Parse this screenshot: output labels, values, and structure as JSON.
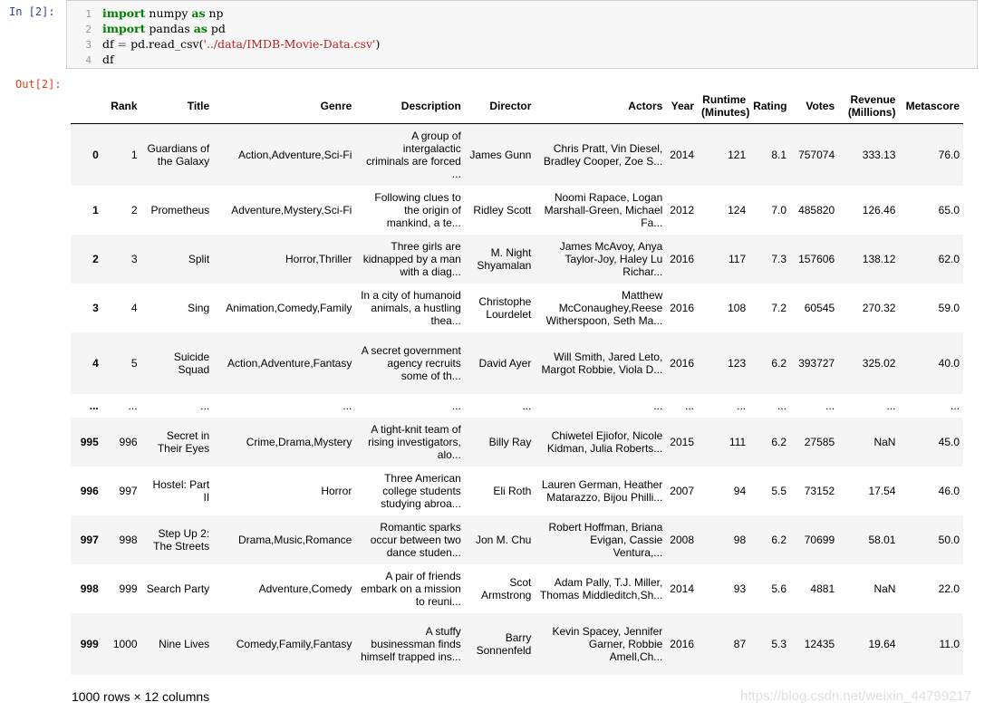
{
  "cell": {
    "in_prompt": "In  [2]:",
    "out_prompt": "Out[2]:",
    "code": [
      {
        "n": "1",
        "parts": [
          {
            "t": "import",
            "c": "kw"
          },
          {
            "t": " numpy ",
            "c": ""
          },
          {
            "t": "as",
            "c": "kw"
          },
          {
            "t": " np",
            "c": ""
          }
        ]
      },
      {
        "n": "2",
        "parts": [
          {
            "t": "import",
            "c": "kw"
          },
          {
            "t": " pandas ",
            "c": ""
          },
          {
            "t": "as",
            "c": "kw"
          },
          {
            "t": " pd",
            "c": ""
          }
        ]
      },
      {
        "n": "3",
        "parts": [
          {
            "t": "df ",
            "c": ""
          },
          {
            "t": "=",
            "c": "op"
          },
          {
            "t": " pd.read_csv(",
            "c": ""
          },
          {
            "t": "'../data/IMDB-Movie-Data.csv'",
            "c": "str"
          },
          {
            "t": ")",
            "c": ""
          }
        ]
      },
      {
        "n": "4",
        "parts": [
          {
            "t": "df",
            "c": ""
          }
        ]
      }
    ]
  },
  "table": {
    "columns": [
      "",
      "Rank",
      "Title",
      "Genre",
      "Description",
      "Director",
      "Actors",
      "Year",
      "Runtime (Minutes)",
      "Rating",
      "Votes",
      "Revenue (Millions)",
      "Metascore"
    ],
    "rows": [
      [
        "0",
        "1",
        "Guardians of the Galaxy",
        "Action,Adventure,Sci-Fi",
        "A group of intergalactic criminals are forced ...",
        "James Gunn",
        "Chris Pratt, Vin Diesel, Bradley Cooper, Zoe S...",
        "2014",
        "121",
        "8.1",
        "757074",
        "333.13",
        "76.0"
      ],
      [
        "1",
        "2",
        "Prometheus",
        "Adventure,Mystery,Sci-Fi",
        "Following clues to the origin of mankind, a te...",
        "Ridley Scott",
        "Noomi Rapace, Logan Marshall-Green, Michael Fa...",
        "2012",
        "124",
        "7.0",
        "485820",
        "126.46",
        "65.0"
      ],
      [
        "2",
        "3",
        "Split",
        "Horror,Thriller",
        "Three girls are kidnapped by a man with a diag...",
        "M. Night Shyamalan",
        "James McAvoy, Anya Taylor-Joy, Haley Lu Richar...",
        "2016",
        "117",
        "7.3",
        "157606",
        "138.12",
        "62.0"
      ],
      [
        "3",
        "4",
        "Sing",
        "Animation,Comedy,Family",
        "In a city of humanoid animals, a hustling thea...",
        "Christophe Lourdelet",
        "Matthew McConaughey,Reese Witherspoon, Seth Ma...",
        "2016",
        "108",
        "7.2",
        "60545",
        "270.32",
        "59.0"
      ],
      [
        "4",
        "5",
        "Suicide Squad",
        "Action,Adventure,Fantasy",
        "A secret government agency recruits some of th...",
        "David Ayer",
        "Will Smith, Jared Leto, Margot Robbie, Viola D...",
        "2016",
        "123",
        "6.2",
        "393727",
        "325.02",
        "40.0"
      ],
      [
        "...",
        "...",
        "...",
        "...",
        "...",
        "...",
        "...",
        "...",
        "...",
        "...",
        "...",
        "...",
        "..."
      ],
      [
        "995",
        "996",
        "Secret in Their Eyes",
        "Crime,Drama,Mystery",
        "A tight-knit team of rising investigators, alo...",
        "Billy Ray",
        "Chiwetel Ejiofor, Nicole Kidman, Julia Roberts...",
        "2015",
        "111",
        "6.2",
        "27585",
        "NaN",
        "45.0"
      ],
      [
        "996",
        "997",
        "Hostel: Part II",
        "Horror",
        "Three American college students studying abroa...",
        "Eli Roth",
        "Lauren German, Heather Matarazzo, Bijou Philli...",
        "2007",
        "94",
        "5.5",
        "73152",
        "17.54",
        "46.0"
      ],
      [
        "997",
        "998",
        "Step Up 2: The Streets",
        "Drama,Music,Romance",
        "Romantic sparks occur between two dance studen...",
        "Jon M. Chu",
        "Robert Hoffman, Briana Evigan, Cassie Ventura,...",
        "2008",
        "98",
        "6.2",
        "70699",
        "58.01",
        "50.0"
      ],
      [
        "998",
        "999",
        "Search Party",
        "Adventure,Comedy",
        "A pair of friends embark on a mission to reuni...",
        "Scot Armstrong",
        "Adam Pally, T.J. Miller, Thomas Middleditch,Sh...",
        "2014",
        "93",
        "5.6",
        "4881",
        "NaN",
        "22.0"
      ],
      [
        "999",
        "1000",
        "Nine Lives",
        "Comedy,Family,Fantasy",
        "A stuffy businessman finds himself trapped ins...",
        "Barry Sonnenfeld",
        "Kevin Spacey, Jennifer Garner, Robbie Amell,Ch...",
        "2016",
        "87",
        "5.3",
        "12435",
        "19.64",
        "11.0"
      ]
    ],
    "footer": "1000 rows × 12 columns"
  },
  "watermark": "https://blog.csdn.net/weixin_44799217"
}
